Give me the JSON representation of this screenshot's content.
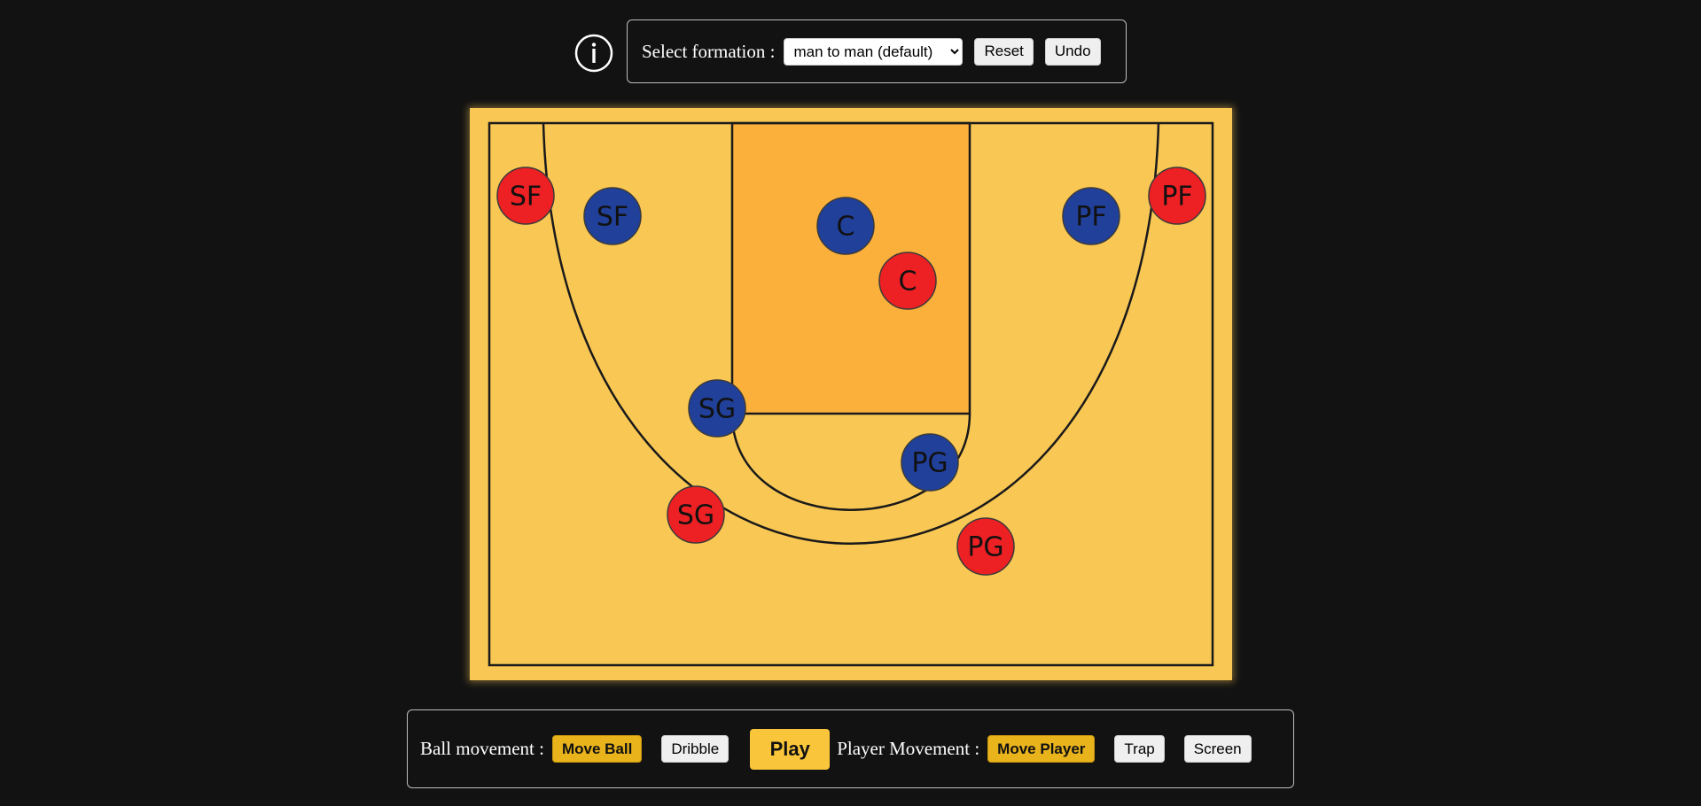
{
  "colors": {
    "background": "#121212",
    "court": "#f9c754",
    "paint": "#fbb03b",
    "lines": "#1a1a1a",
    "team_red": "#ed2024",
    "team_blue": "#21409a",
    "active_button": "#e9b31c",
    "play_button": "#f9c53a"
  },
  "header": {
    "info_icon": "info-icon",
    "select_label": "Select formation :",
    "formation": {
      "selected": "man to man (default)",
      "options": [
        "man to man (default)"
      ]
    },
    "reset_label": "Reset",
    "undo_label": "Undo"
  },
  "court": {
    "players": [
      {
        "team": "red",
        "label": "SF"
      },
      {
        "team": "blue",
        "label": "SF"
      },
      {
        "team": "blue",
        "label": "C"
      },
      {
        "team": "red",
        "label": "C"
      },
      {
        "team": "blue",
        "label": "PF"
      },
      {
        "team": "red",
        "label": "PF"
      },
      {
        "team": "blue",
        "label": "SG"
      },
      {
        "team": "blue",
        "label": "PG"
      },
      {
        "team": "red",
        "label": "SG"
      },
      {
        "team": "red",
        "label": "PG"
      }
    ]
  },
  "controls": {
    "ball_label": "Ball movement :",
    "move_ball_label": "Move Ball",
    "dribble_label": "Dribble",
    "play_label": "Play",
    "player_label": "Player Movement :",
    "move_player_label": "Move Player",
    "trap_label": "Trap",
    "screen_label": "Screen"
  }
}
